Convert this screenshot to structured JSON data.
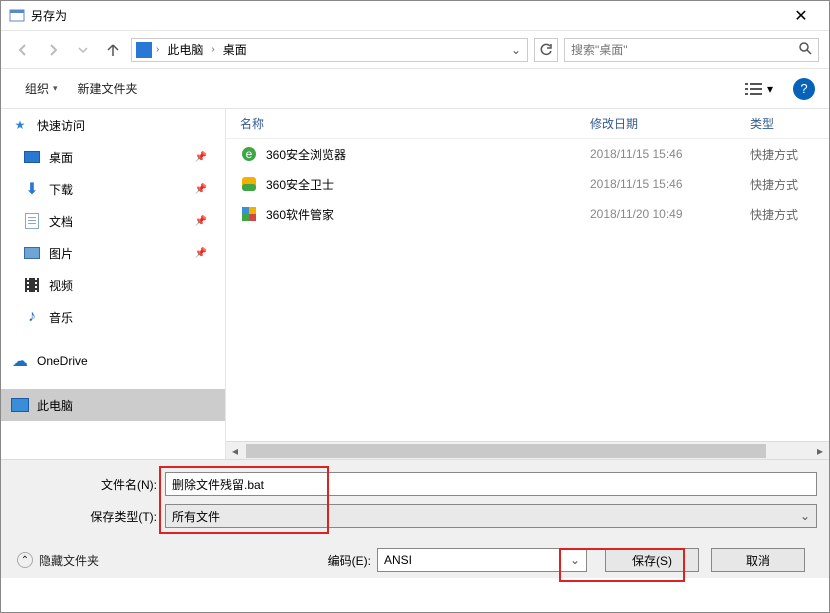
{
  "window": {
    "title": "另存为",
    "close_glyph": "✕"
  },
  "nav": {
    "path_segments": [
      "此电脑",
      "桌面"
    ],
    "search_placeholder": "搜索\"桌面\""
  },
  "toolbar": {
    "organize": "组织",
    "new_folder": "新建文件夹"
  },
  "sidebar": {
    "quick_access": "快速访问",
    "items": [
      {
        "label": "桌面",
        "icon": "monitor"
      },
      {
        "label": "下载",
        "icon": "download"
      },
      {
        "label": "文档",
        "icon": "doc"
      },
      {
        "label": "图片",
        "icon": "picture"
      },
      {
        "label": "视频",
        "icon": "video"
      },
      {
        "label": "音乐",
        "icon": "music"
      }
    ],
    "onedrive": "OneDrive",
    "this_pc": "此电脑"
  },
  "columns": {
    "name": "名称",
    "modified": "修改日期",
    "type": "类型"
  },
  "files": [
    {
      "name": "360安全浏览器",
      "date": "2018/11/15 15:46",
      "type": "快捷方式",
      "icon_color": "#3fa648"
    },
    {
      "name": "360安全卫士",
      "date": "2018/11/15 15:46",
      "type": "快捷方式",
      "icon_color": "#f2b100"
    },
    {
      "name": "360软件管家",
      "date": "2018/11/20 10:49",
      "type": "快捷方式",
      "icon_color": "#3a8ed8"
    }
  ],
  "form": {
    "filename_label": "文件名(N):",
    "filename_value": "删除文件残留.bat",
    "filetype_label": "保存类型(T):",
    "filetype_value": "所有文件"
  },
  "bottom": {
    "hide_folders": "隐藏文件夹",
    "encoding_label": "编码(E):",
    "encoding_value": "ANSI",
    "save_label": "保存(S)",
    "cancel_label": "取消"
  }
}
